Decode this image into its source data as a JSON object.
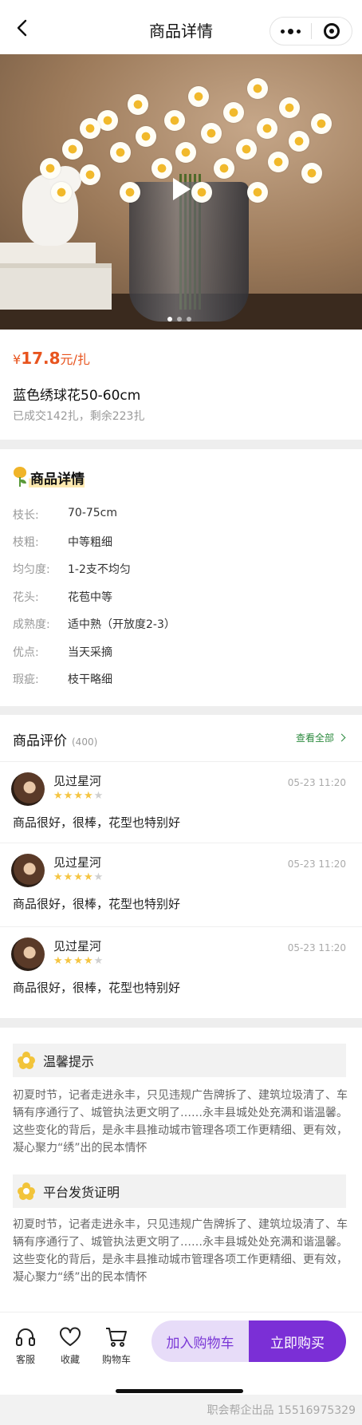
{
  "nav": {
    "title": "商品详情"
  },
  "product": {
    "price_symbol": "¥",
    "price": "17.8",
    "price_unit": "元/扎",
    "name": "蓝色绣球花50-60cm",
    "sales": "已成交142扎，剩余223扎"
  },
  "details": {
    "title": "商品详情",
    "attrs": [
      {
        "k": "枝长:",
        "v": "70-75cm"
      },
      {
        "k": "枝粗:",
        "v": "中等粗细"
      },
      {
        "k": "均匀度:",
        "v": "1-2支不均匀"
      },
      {
        "k": "花头:",
        "v": "花苞中等"
      },
      {
        "k": "成熟度:",
        "v": "适中熟（开放度2-3）"
      },
      {
        "k": "优点:",
        "v": "当天采摘"
      },
      {
        "k": "瑕疵:",
        "v": "枝干略细"
      }
    ]
  },
  "reviews": {
    "title": "商品评价",
    "count": "(400)",
    "view_all": "查看全部",
    "items": [
      {
        "name": "见过星河",
        "stars": 4,
        "time": "05-23 11:20",
        "text": "商品很好，很棒，花型也特别好"
      },
      {
        "name": "见过星河",
        "stars": 4,
        "time": "05-23 11:20",
        "text": "商品很好，很棒，花型也特别好"
      },
      {
        "name": "见过星河",
        "stars": 4,
        "time": "05-23 11:20",
        "text": "商品很好，很棒，花型也特别好"
      }
    ]
  },
  "notices": [
    {
      "title": "温馨提示",
      "body": "初夏时节，记者走进永丰，只见违规广告牌拆了、建筑垃圾清了、车辆有序通行了、城管执法更文明了……永丰县城处处充满和谐温馨。这些变化的背后，是永丰县推动城市管理各项工作更精细、更有效，凝心聚力“绣”出的民本情怀"
    },
    {
      "title": "平台发货证明",
      "body": "初夏时节，记者走进永丰，只见违规广告牌拆了、建筑垃圾清了、车辆有序通行了、城管执法更文明了……永丰县城处处充满和谐温馨。这些变化的背后，是永丰县推动城市管理各项工作更精细、更有效，凝心聚力“绣”出的民本情怀"
    }
  ],
  "bottombar": {
    "service": "客服",
    "favorite": "收藏",
    "cart": "购物车",
    "add_to_cart": "加入购物车",
    "buy_now": "立即购买"
  },
  "watermark": "职会帮企出品 15516975329",
  "colors": {
    "price": "#e8541e",
    "accent": "#7b2fd6",
    "accent_light": "#e7dcf8",
    "link": "#2b8a3e",
    "star": "#f5c542"
  }
}
